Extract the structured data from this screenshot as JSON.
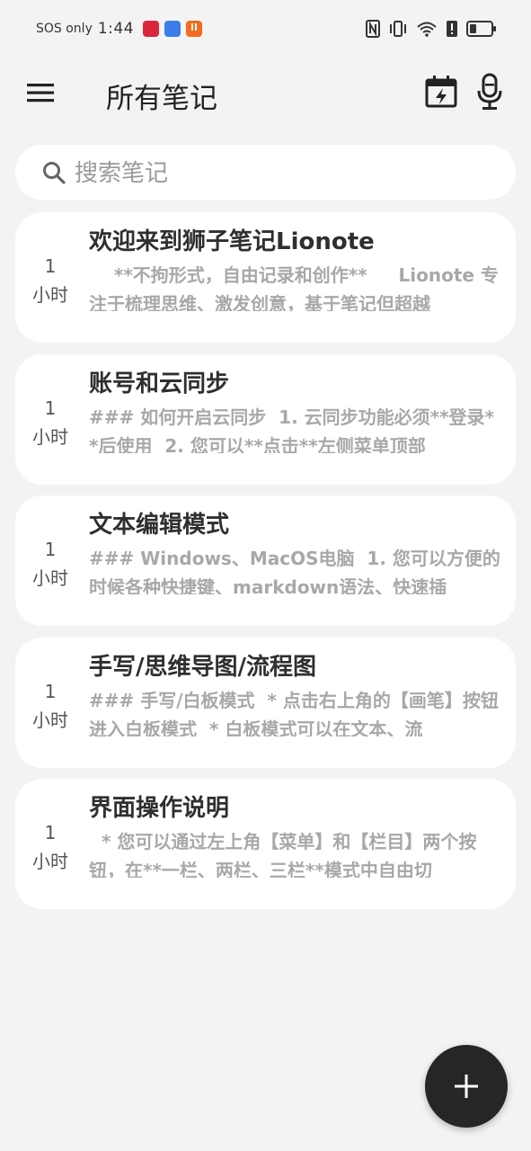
{
  "status_bar": {
    "sos": "SOS only",
    "time": "1:44",
    "app_icons": [
      "news-app-icon",
      "notes-app-icon",
      "download-app-icon"
    ],
    "right_icons": [
      "nfc-icon",
      "vibrate-icon",
      "wifi-icon",
      "alert-icon",
      "battery-icon"
    ]
  },
  "header": {
    "title": "所有笔记",
    "menu_icon": "hamburger-icon",
    "calendar_icon": "calendar-bolt-icon",
    "mic_icon": "microphone-icon"
  },
  "search": {
    "placeholder": "搜索笔记",
    "value": ""
  },
  "notes": [
    {
      "time_value": "1",
      "time_unit": "小时",
      "title": "欢迎来到狮子笔记Lionote",
      "preview": "    **不拘形式，自由记录和创作**     Lionote 专注于梳理思维、激发创意，基于笔记但超越"
    },
    {
      "time_value": "1",
      "time_unit": "小时",
      "title": "账号和云同步",
      "preview": "### 如何开启云同步  1. 云同步功能必须**登录**后使用  2. 您可以**点击**左侧菜单顶部"
    },
    {
      "time_value": "1",
      "time_unit": "小时",
      "title": "文本编辑模式",
      "preview": "### Windows、MacOS电脑  1. 您可以方便的时候各种快捷键、markdown语法、快速插"
    },
    {
      "time_value": "1",
      "time_unit": "小时",
      "title": "手写/思维导图/流程图",
      "preview": "### 手写/白板模式  * 点击右上角的【画笔】按钮进入白板模式  * 白板模式可以在文本、流"
    },
    {
      "time_value": "1",
      "time_unit": "小时",
      "title": "界面操作说明",
      "preview": "  * 您可以通过左上角【菜单】和【栏目】两个按钮，在**一栏、两栏、三栏**模式中自由切"
    }
  ],
  "fab": {
    "icon": "plus-icon"
  },
  "colors": {
    "background": "#f3f3f3",
    "card": "#ffffff",
    "fab": "#262626",
    "preview_text": "#a8a8a8"
  }
}
